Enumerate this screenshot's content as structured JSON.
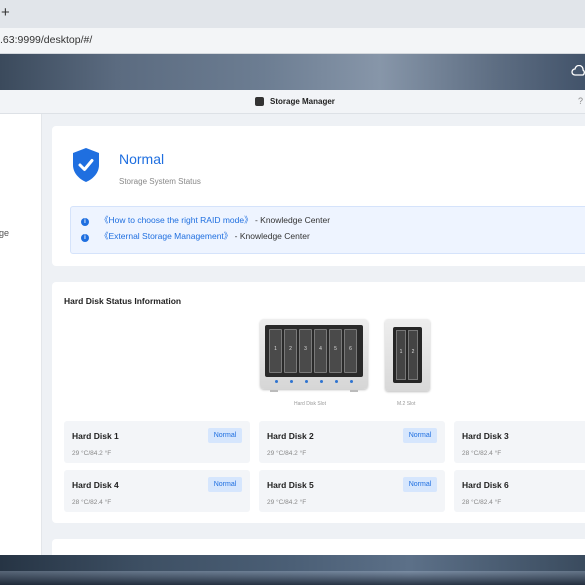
{
  "browser": {
    "new_tab_label": "+",
    "url": ".63:9999/desktop/#/"
  },
  "window": {
    "title": "Storage Manager",
    "help_label": "?"
  },
  "sidebar": {
    "fragment": "ge"
  },
  "status": {
    "title": "Normal",
    "subtitle": "Storage System Status",
    "links": [
      {
        "link_text": "《How to choose the right RAID mode》",
        "suffix": " - Knowledge Center"
      },
      {
        "link_text": "《External Storage Management》",
        "suffix": " - Knowledge Center"
      }
    ]
  },
  "disks": {
    "heading": "Hard Disk Status Information",
    "enclosure": {
      "bays": [
        "1",
        "2",
        "3",
        "4",
        "5",
        "6"
      ],
      "label": "Hard Disk Slot"
    },
    "m2": {
      "bays": [
        "1",
        "2"
      ],
      "label": "M.2 Slot"
    },
    "items": [
      {
        "name": "Hard Disk 1",
        "temp": "29 °C/84.2 °F",
        "status": "Normal"
      },
      {
        "name": "Hard Disk 2",
        "temp": "29 °C/84.2 °F",
        "status": "Normal"
      },
      {
        "name": "Hard Disk 3",
        "temp": "28 °C/82.4 °F",
        "status": ""
      },
      {
        "name": "Hard Disk 4",
        "temp": "28 °C/82.4 °F",
        "status": "Normal"
      },
      {
        "name": "Hard Disk 5",
        "temp": "29 °C/84.2 °F",
        "status": "Normal"
      },
      {
        "name": "Hard Disk 6",
        "temp": "28 °C/82.4 °F",
        "status": ""
      }
    ]
  },
  "colors": {
    "accent": "#1f6fe0",
    "badge_bg": "#d6e6fd"
  },
  "icons": {
    "status": "shield-check-icon",
    "info": "info-circle-icon",
    "app": "storage-manager-icon",
    "tray": "cloud-icon"
  }
}
